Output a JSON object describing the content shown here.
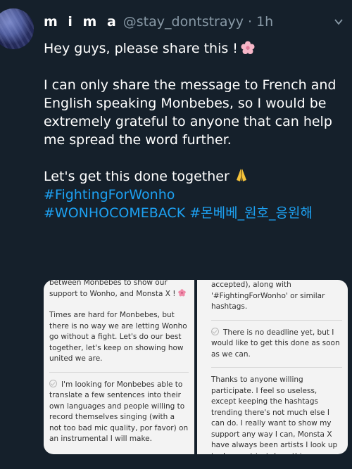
{
  "tweet": {
    "display_name": "m i m a",
    "handle": "@stay_dontstrayy",
    "separator": "·",
    "time": "1h",
    "lines": {
      "intro": "Hey guys, please share this !",
      "para2": "I can only share the message to French and English speaking Monbebes, so I would be extremely grateful to anyone that can help me spread the word further.",
      "closing": "Let's get this done together",
      "hashtag1": "#FightingForWonho",
      "hashtag2": "#WONHOCOMEBACK",
      "hashtag3": "#몬베베_원호_응원해"
    },
    "emoji": {
      "flower": "cherry-blossom-icon",
      "hands": "folded-hands-icon"
    }
  },
  "media": {
    "left_panel": {
      "top_fragment": "between Monbebes to show our support to Wonho, and Monsta X !",
      "para": "Times are hard for Monbebes, but there is no way we are letting Wonho go without a fight. Let's do our best together, let's keep on showing how united we are.",
      "item": "I'm looking for Monbebes able to translate a few sentences into their own languages and people willing to record themselves singing (with a not too bad mic quality, por favor) on an instrumental I will make."
    },
    "right_panel": {
      "top_fragment": "accepted), along with '#FightingForWonho' or similar hashtags.",
      "item": "There is no deadline yet, but I would like to get this done as soon as we can.",
      "para": "Thanks to anyone willing participate. I feel so useless, except keeping the hashtags trending there's not much else I can do. I really want to show my support any way I can, Monsta X have always been artists I look up to. I cannot just do nothing."
    }
  },
  "colors": {
    "background": "#15202b",
    "link": "#1da1f2",
    "muted": "#8899a6"
  }
}
